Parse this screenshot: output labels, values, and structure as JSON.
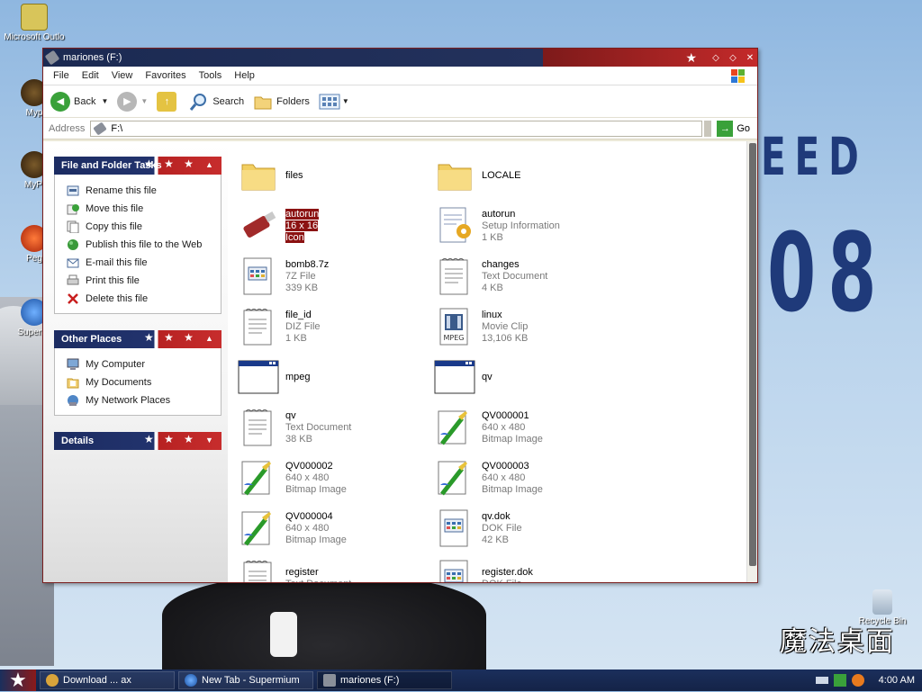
{
  "desktop": {
    "icons": [
      {
        "label": "Microsoft Outlo"
      },
      {
        "label": "Myp"
      },
      {
        "label": "MyPl"
      },
      {
        "label": "Peg"
      },
      {
        "label": "Supermi"
      }
    ],
    "wallpaper_text": {
      "line1": "EED",
      "line2": "08",
      "logo": "魔法桌面"
    },
    "recycle_bin": "Recycle Bin"
  },
  "window": {
    "title": "mariones (F:)",
    "menu": [
      "File",
      "Edit",
      "View",
      "Favorites",
      "Tools",
      "Help"
    ],
    "toolbar": {
      "back": "Back",
      "search": "Search",
      "folders": "Folders"
    },
    "address": {
      "label": "Address",
      "value": "F:\\",
      "go": "Go"
    }
  },
  "tasks": {
    "file_folder": {
      "title": "File and Folder Tasks",
      "items": [
        {
          "label": "Rename this file",
          "icon": "rename-icon"
        },
        {
          "label": "Move this file",
          "icon": "move-icon"
        },
        {
          "label": "Copy this file",
          "icon": "copy-icon"
        },
        {
          "label": "Publish this file to the Web",
          "icon": "publish-icon"
        },
        {
          "label": "E-mail this file",
          "icon": "email-icon"
        },
        {
          "label": "Print this file",
          "icon": "print-icon"
        },
        {
          "label": "Delete this file",
          "icon": "delete-icon"
        }
      ]
    },
    "other_places": {
      "title": "Other Places",
      "items": [
        {
          "label": "My Computer",
          "icon": "computer-icon"
        },
        {
          "label": "My Documents",
          "icon": "documents-icon"
        },
        {
          "label": "My Network Places",
          "icon": "network-icon"
        }
      ]
    },
    "details": {
      "title": "Details"
    }
  },
  "files": [
    {
      "name": "files",
      "type": "",
      "size": "",
      "icon": "folder-icon"
    },
    {
      "name": "LOCALE",
      "type": "",
      "size": "",
      "icon": "folder-icon"
    },
    {
      "name": "autorun",
      "type": "16 x 16",
      "size": "Icon",
      "icon": "usb-drive-icon",
      "selected": true
    },
    {
      "name": "autorun",
      "type": "Setup Information",
      "size": "1 KB",
      "icon": "setup-info-icon"
    },
    {
      "name": "bomb8.7z",
      "type": "7Z File",
      "size": "339 KB",
      "icon": "generic-file-icon"
    },
    {
      "name": "changes",
      "type": "Text Document",
      "size": "4 KB",
      "icon": "text-document-icon"
    },
    {
      "name": "file_id",
      "type": "DIZ File",
      "size": "1 KB",
      "icon": "text-document-icon"
    },
    {
      "name": "linux",
      "type": "Movie Clip",
      "size": "13,106 KB",
      "icon": "mpeg-icon"
    },
    {
      "name": "mpeg",
      "type": "",
      "size": "",
      "icon": "application-icon"
    },
    {
      "name": "qv",
      "type": "",
      "size": "",
      "icon": "application-icon"
    },
    {
      "name": "qv",
      "type": "Text Document",
      "size": "38 KB",
      "icon": "text-document-icon"
    },
    {
      "name": "QV000001",
      "type": "640 x 480",
      "size": "Bitmap Image",
      "icon": "bitmap-icon"
    },
    {
      "name": "QV000002",
      "type": "640 x 480",
      "size": "Bitmap Image",
      "icon": "bitmap-icon"
    },
    {
      "name": "QV000003",
      "type": "640 x 480",
      "size": "Bitmap Image",
      "icon": "bitmap-icon"
    },
    {
      "name": "QV000004",
      "type": "640 x 480",
      "size": "Bitmap Image",
      "icon": "bitmap-icon"
    },
    {
      "name": "qv.dok",
      "type": "DOK File",
      "size": "42 KB",
      "icon": "generic-file-icon"
    },
    {
      "name": "register",
      "type": "Text Document",
      "size": "",
      "icon": "text-document-icon"
    },
    {
      "name": "register.dok",
      "type": "DOK File",
      "size": "",
      "icon": "generic-file-icon"
    }
  ],
  "taskbar": {
    "items": [
      {
        "label": "Download ... ax"
      },
      {
        "label": "New Tab - Supermium"
      },
      {
        "label": "mariones (F:)"
      }
    ],
    "clock": "4:00 AM"
  },
  "colors": {
    "titlebar_blue": "#1b2a52",
    "titlebar_red": "#c42a2a",
    "selection": "#8b1212"
  }
}
